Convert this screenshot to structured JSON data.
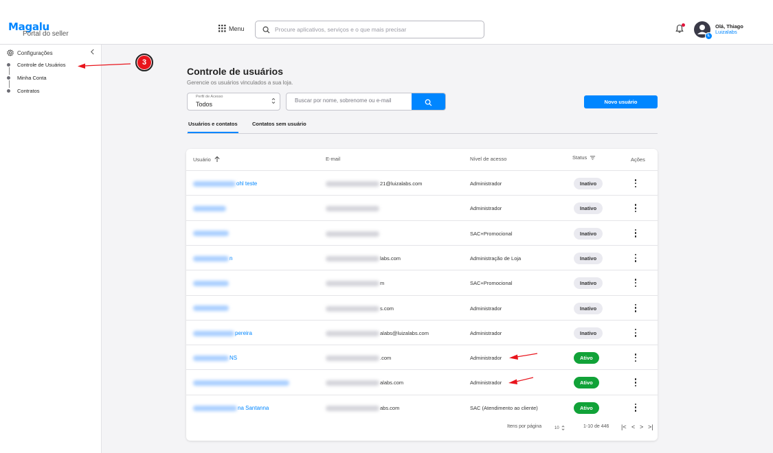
{
  "header": {
    "logo": "Magalu",
    "logo_sub": "Portal do seller",
    "menu_label": "Menu",
    "search_placeholder": "Procure aplicativos, serviços e o que mais precisar",
    "greeting": "Olá, Thiago",
    "org": "Luizalabs",
    "avatar_initial": "L"
  },
  "sidebar": {
    "section": "Configurações",
    "items": [
      {
        "label": "Controle de Usuários"
      },
      {
        "label": "Minha Conta"
      },
      {
        "label": "Contratos"
      }
    ]
  },
  "annotation": {
    "step": "3"
  },
  "page": {
    "title": "Controle de usuários",
    "subtitle": "Gerencie os usuários vinculados a sua loja.",
    "profile_filter_label": "Perfil de Acesso",
    "profile_filter_value": "Todos",
    "user_search_placeholder": "Buscar por nome, sobrenome ou e-mail",
    "new_user_button": "Novo usuário",
    "tabs": [
      "Usuários e contatos",
      "Contatos sem usuário"
    ]
  },
  "table": {
    "columns": [
      "Usuário",
      "E-mail",
      "Nível de acesso",
      "Status",
      "Ações"
    ],
    "rows": [
      {
        "user": "ohl teste",
        "email": "21@luizalabs.com",
        "level": "Administrador",
        "status": "Inativo"
      },
      {
        "user": "",
        "email": "",
        "level": "Administrador",
        "status": "Inativo"
      },
      {
        "user": "",
        "email": "",
        "level": "SAC+Promocional",
        "status": "Inativo"
      },
      {
        "user": "n",
        "email": "labs.com",
        "level": "Administração de Loja",
        "status": "Inativo"
      },
      {
        "user": "",
        "email": "m",
        "level": "SAC+Promocional",
        "status": "Inativo"
      },
      {
        "user": "",
        "email": "s.com",
        "level": "Administrador",
        "status": "Inativo"
      },
      {
        "user": "pereira",
        "email": "alabs@luizalabs.com",
        "level": "Administrador",
        "status": "Inativo"
      },
      {
        "user": "NS",
        "email": ".com",
        "level": "Administrador",
        "status": "Ativo"
      },
      {
        "user": "",
        "email": "alabs.com",
        "level": "Administrador",
        "status": "Ativo"
      },
      {
        "user": "na Santanna",
        "email": "abs.com",
        "level": "SAC (Atendimento ao cliente)",
        "status": "Ativo"
      }
    ]
  },
  "pagination": {
    "items_per_page_label": "Itens por página",
    "items_per_page": "10",
    "range": "1-10 de 446"
  },
  "colors": {
    "accent": "#0086ff",
    "active": "#11a238",
    "annotation": "#e8141c"
  }
}
